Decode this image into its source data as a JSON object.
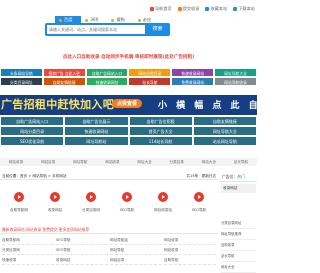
{
  "topnav": [
    {
      "label": "导航首页",
      "color": "#e6443a",
      "icon": "home-icon"
    },
    {
      "label": "提交收录",
      "color": "#f57d1f",
      "icon": "submit-icon"
    },
    {
      "label": "收藏本站",
      "color": "#1e8ce0",
      "icon": "star-icon"
    },
    {
      "label": "下载本站",
      "color": "#2aa56b",
      "icon": "download-icon"
    }
  ],
  "search": {
    "tabs": [
      "百度",
      "360",
      "搜狗",
      "必应"
    ],
    "active_tab": "百度",
    "placeholder": "请输入关键词，站点，关键词搜索本站",
    "button": "搜索"
  },
  "notice": "点此入口自助收录 自动同步手机端 审核即时展现(此处广告招租)",
  "grid6": [
    {
      "label": "头条网站导航",
      "color": "#1b7fb6"
    },
    {
      "label": "招商广告 点此入驻",
      "color": "#e84b3c"
    },
    {
      "label": "自助广告网站入口",
      "color": "#2aa56b"
    },
    {
      "label": "网站分类目录",
      "color": "#f39c12"
    },
    {
      "label": "快速收录网站",
      "color": "#8e44ad"
    },
    {
      "label": "网址导航大全",
      "color": "#16a085"
    },
    {
      "label": "分类目录网址",
      "color": "#2c3e50"
    },
    {
      "label": "自助友情链接",
      "color": "#d35400"
    },
    {
      "label": "快速收录网址",
      "color": "#27ae60"
    },
    {
      "label": "站长导航",
      "color": "#c0392b"
    },
    {
      "label": "免费收录网站",
      "color": "#2980b9"
    },
    {
      "label": "网站导航收录",
      "color": "#7f8c8d"
    }
  ],
  "banner": {
    "left": "广告招租中赶快加入吧",
    "pill": "点我查看",
    "right": "小 横 幅   点 此 自 助"
  },
  "grid4": [
    "自助广告网站入口",
    "自助广告位展示",
    "自助广告位招租",
    "自助友情链接",
    "网站分类目录",
    "快速收录网站",
    "首页广告大全",
    "网址导航大全",
    "SEO优化导航",
    "网址导航站",
    "114站长导航",
    "站长网址导航"
  ],
  "links": [
    "网址收录",
    "网站目录",
    "网址导航",
    "网站收录",
    "网址大全",
    "分类目录",
    "网站大全",
    "站长导航"
  ],
  "crumb": "当前位置：首页 > 网站导航 > 手机网站",
  "crumb_right": "共15条 · 更新日志",
  "cards": [
    "自助导航网",
    "收录网站",
    "分类目录网",
    "SEO导航",
    "网址收录站",
    "SEO导航"
  ],
  "list_head": "最新收录网站 网站收录 免费提交 更多优质网站推荐",
  "list": [
    "自助导航网",
    "SEO导航",
    "网址导航站",
    "网址收录",
    "分类目录网",
    "SEO导航",
    "网址导航",
    "网站收录",
    "快速收录",
    "收录网站",
    "网站目录",
    "自助导航"
  ],
  "side": {
    "title": "广告位：",
    "title_hl": "热门",
    "ad": "收录网站",
    "rows": [
      "分类目录网址",
      "网址导航推荐",
      "自助收录",
      "站长导航",
      "网址大全"
    ]
  }
}
